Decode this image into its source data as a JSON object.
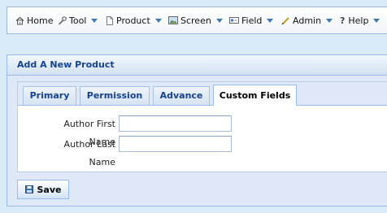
{
  "menu": {
    "items": [
      {
        "label": "Home",
        "icon": "home-icon"
      },
      {
        "label": "Tool",
        "icon": "wrench-icon"
      },
      {
        "label": "Product",
        "icon": "document-icon"
      },
      {
        "label": "Screen",
        "icon": "screen-image-icon"
      },
      {
        "label": "Field",
        "icon": "field-icon"
      },
      {
        "label": "Admin",
        "icon": "pencil-icon"
      },
      {
        "label": "Help",
        "icon": "question-icon"
      }
    ]
  },
  "panel": {
    "title": "Add A New Product",
    "tabs": [
      {
        "label": "Primary",
        "active": false
      },
      {
        "label": "Permission",
        "active": false
      },
      {
        "label": "Advance",
        "active": false
      },
      {
        "label": "Custom Fields",
        "active": true
      }
    ],
    "fields": [
      {
        "label": "Author First Name",
        "value": ""
      },
      {
        "label": "Author Last Name",
        "value": ""
      }
    ],
    "save_label": "Save"
  },
  "colors": {
    "background": "#d9ebf7",
    "accent": "#3f79b4",
    "header_text": "#15428b"
  }
}
